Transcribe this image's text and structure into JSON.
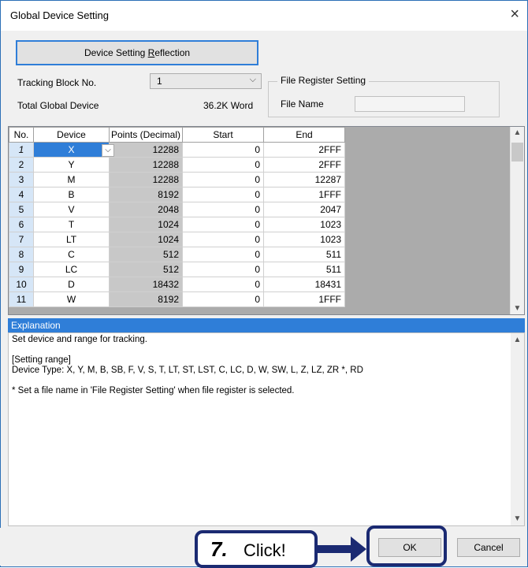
{
  "window": {
    "title": "Global Device Setting",
    "close_glyph": "×"
  },
  "reflect_button": {
    "label_pre": "Device Setting ",
    "label_key": "R",
    "label_post": "eflection"
  },
  "tracking": {
    "label": "Tracking Block No.",
    "value": "1",
    "arrow": "⌵"
  },
  "total": {
    "label": "Total Global Device",
    "value": "36.2K Word"
  },
  "file_register": {
    "group_title": "File Register Setting",
    "file_name_label": "File Name",
    "file_name_value": ""
  },
  "table": {
    "headers": [
      "No.",
      "Device",
      "Points (Decimal)",
      "Start",
      "End"
    ],
    "rows": [
      {
        "no": "1",
        "device": "X",
        "points": "12288",
        "start": "0",
        "end": "2FFF"
      },
      {
        "no": "2",
        "device": "Y",
        "points": "12288",
        "start": "0",
        "end": "2FFF"
      },
      {
        "no": "3",
        "device": "M",
        "points": "12288",
        "start": "0",
        "end": "12287"
      },
      {
        "no": "4",
        "device": "B",
        "points": "8192",
        "start": "0",
        "end": "1FFF"
      },
      {
        "no": "5",
        "device": "V",
        "points": "2048",
        "start": "0",
        "end": "2047"
      },
      {
        "no": "6",
        "device": "T",
        "points": "1024",
        "start": "0",
        "end": "1023"
      },
      {
        "no": "7",
        "device": "LT",
        "points": "1024",
        "start": "0",
        "end": "1023"
      },
      {
        "no": "8",
        "device": "C",
        "points": "512",
        "start": "0",
        "end": "511"
      },
      {
        "no": "9",
        "device": "LC",
        "points": "512",
        "start": "0",
        "end": "511"
      },
      {
        "no": "10",
        "device": "D",
        "points": "18432",
        "start": "0",
        "end": "18431"
      },
      {
        "no": "11",
        "device": "W",
        "points": "8192",
        "start": "0",
        "end": "1FFF"
      }
    ],
    "dropdown_arrow": "⌵"
  },
  "explanation": {
    "header": "Explanation",
    "line1": "Set device and range for tracking.",
    "line2": "[Setting range]",
    "line3": "Device Type: X, Y, M, B, SB, F, V, S, T, LT, ST, LST, C, LC, D, W, SW, L, Z, LZ, ZR *, RD",
    "line4": "* Set a file name in 'File Register Setting' when file register is selected."
  },
  "buttons": {
    "ok": "OK",
    "cancel": "Cancel"
  },
  "callout": {
    "step": "7.",
    "text": "Click!"
  },
  "scroll": {
    "up": "▲",
    "down": "▼"
  }
}
